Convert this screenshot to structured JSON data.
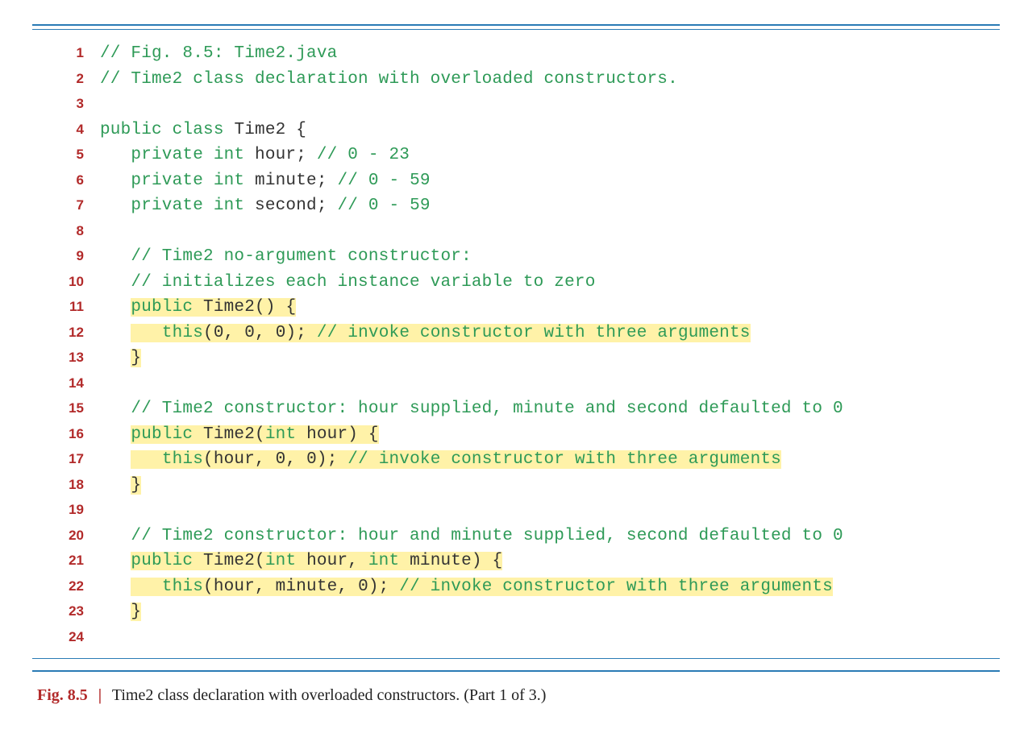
{
  "caption": {
    "fig": "Fig. 8.5",
    "bar": "|",
    "text": "Time2 class declaration with overloaded constructors. (Part 1 of 3.)"
  },
  "lines": [
    {
      "n": "1",
      "segs": [
        {
          "t": "// Fig. 8.5: Time2.java",
          "c": "cm"
        }
      ]
    },
    {
      "n": "2",
      "segs": [
        {
          "t": "// Time2 class declaration with overloaded constructors.",
          "c": "cm"
        }
      ]
    },
    {
      "n": "3",
      "segs": [
        {
          "t": "",
          "c": "pl"
        }
      ]
    },
    {
      "n": "4",
      "segs": [
        {
          "t": "public class ",
          "c": "kw"
        },
        {
          "t": "Time2 {",
          "c": "pl"
        }
      ]
    },
    {
      "n": "5",
      "segs": [
        {
          "t": "   ",
          "c": "pl"
        },
        {
          "t": "private int ",
          "c": "kw"
        },
        {
          "t": "hour; ",
          "c": "pl"
        },
        {
          "t": "// 0 - 23",
          "c": "cm"
        }
      ]
    },
    {
      "n": "6",
      "segs": [
        {
          "t": "   ",
          "c": "pl"
        },
        {
          "t": "private int ",
          "c": "kw"
        },
        {
          "t": "minute; ",
          "c": "pl"
        },
        {
          "t": "// 0 - 59",
          "c": "cm"
        }
      ]
    },
    {
      "n": "7",
      "segs": [
        {
          "t": "   ",
          "c": "pl"
        },
        {
          "t": "private int ",
          "c": "kw"
        },
        {
          "t": "second; ",
          "c": "pl"
        },
        {
          "t": "// 0 - 59",
          "c": "cm"
        }
      ]
    },
    {
      "n": "8",
      "segs": [
        {
          "t": "",
          "c": "pl"
        }
      ]
    },
    {
      "n": "9",
      "segs": [
        {
          "t": "   ",
          "c": "pl"
        },
        {
          "t": "// Time2 no-argument constructor:",
          "c": "cm"
        }
      ]
    },
    {
      "n": "10",
      "segs": [
        {
          "t": "   ",
          "c": "pl"
        },
        {
          "t": "// initializes each instance variable to zero",
          "c": "cm"
        }
      ]
    },
    {
      "n": "11",
      "segs": [
        {
          "t": "   ",
          "c": "pl"
        },
        {
          "t": "public ",
          "c": "kw",
          "hl": true
        },
        {
          "t": "Time2() {",
          "c": "pl",
          "hl": true
        }
      ]
    },
    {
      "n": "12",
      "segs": [
        {
          "t": "   ",
          "c": "pl"
        },
        {
          "t": "   ",
          "c": "pl",
          "hl": true
        },
        {
          "t": "this",
          "c": "kw",
          "hl": true
        },
        {
          "t": "(",
          "c": "pl",
          "hl": true
        },
        {
          "t": "0",
          "c": "num",
          "hl": true
        },
        {
          "t": ", ",
          "c": "pl",
          "hl": true
        },
        {
          "t": "0",
          "c": "num",
          "hl": true
        },
        {
          "t": ", ",
          "c": "pl",
          "hl": true
        },
        {
          "t": "0",
          "c": "num",
          "hl": true
        },
        {
          "t": "); ",
          "c": "pl",
          "hl": true
        },
        {
          "t": "// invoke constructor with three arguments",
          "c": "cm",
          "hl": true
        }
      ]
    },
    {
      "n": "13",
      "segs": [
        {
          "t": "   ",
          "c": "pl"
        },
        {
          "t": "}",
          "c": "pl",
          "hl": true
        }
      ]
    },
    {
      "n": "14",
      "segs": [
        {
          "t": "",
          "c": "pl"
        }
      ]
    },
    {
      "n": "15",
      "segs": [
        {
          "t": "   ",
          "c": "pl"
        },
        {
          "t": "// Time2 constructor: hour supplied, minute and second defaulted to 0",
          "c": "cm"
        }
      ]
    },
    {
      "n": "16",
      "segs": [
        {
          "t": "   ",
          "c": "pl"
        },
        {
          "t": "public ",
          "c": "kw",
          "hl": true
        },
        {
          "t": "Time2(",
          "c": "pl",
          "hl": true
        },
        {
          "t": "int ",
          "c": "kw",
          "hl": true
        },
        {
          "t": "hour) {",
          "c": "pl",
          "hl": true
        }
      ]
    },
    {
      "n": "17",
      "segs": [
        {
          "t": "   ",
          "c": "pl"
        },
        {
          "t": "   ",
          "c": "pl",
          "hl": true
        },
        {
          "t": "this",
          "c": "kw",
          "hl": true
        },
        {
          "t": "(hour, ",
          "c": "pl",
          "hl": true
        },
        {
          "t": "0",
          "c": "num",
          "hl": true
        },
        {
          "t": ", ",
          "c": "pl",
          "hl": true
        },
        {
          "t": "0",
          "c": "num",
          "hl": true
        },
        {
          "t": "); ",
          "c": "pl",
          "hl": true
        },
        {
          "t": "// invoke constructor with three arguments",
          "c": "cm",
          "hl": true
        }
      ]
    },
    {
      "n": "18",
      "segs": [
        {
          "t": "   ",
          "c": "pl"
        },
        {
          "t": "}",
          "c": "pl",
          "hl": true
        }
      ]
    },
    {
      "n": "19",
      "segs": [
        {
          "t": "",
          "c": "pl"
        }
      ]
    },
    {
      "n": "20",
      "segs": [
        {
          "t": "   ",
          "c": "pl"
        },
        {
          "t": "// Time2 constructor: hour and minute supplied, second defaulted to 0",
          "c": "cm"
        }
      ]
    },
    {
      "n": "21",
      "segs": [
        {
          "t": "   ",
          "c": "pl"
        },
        {
          "t": "public ",
          "c": "kw",
          "hl": true
        },
        {
          "t": "Time2(",
          "c": "pl",
          "hl": true
        },
        {
          "t": "int ",
          "c": "kw",
          "hl": true
        },
        {
          "t": "hour, ",
          "c": "pl",
          "hl": true
        },
        {
          "t": "int ",
          "c": "kw",
          "hl": true
        },
        {
          "t": "minute) {",
          "c": "pl",
          "hl": true
        }
      ]
    },
    {
      "n": "22",
      "segs": [
        {
          "t": "   ",
          "c": "pl"
        },
        {
          "t": "   ",
          "c": "pl",
          "hl": true
        },
        {
          "t": "this",
          "c": "kw",
          "hl": true
        },
        {
          "t": "(hour, minute, ",
          "c": "pl",
          "hl": true
        },
        {
          "t": "0",
          "c": "num",
          "hl": true
        },
        {
          "t": "); ",
          "c": "pl",
          "hl": true
        },
        {
          "t": "// invoke constructor with three arguments",
          "c": "cm",
          "hl": true
        }
      ]
    },
    {
      "n": "23",
      "segs": [
        {
          "t": "   ",
          "c": "pl"
        },
        {
          "t": "}",
          "c": "pl",
          "hl": true
        }
      ]
    },
    {
      "n": "24",
      "segs": [
        {
          "t": "",
          "c": "pl"
        }
      ]
    }
  ]
}
